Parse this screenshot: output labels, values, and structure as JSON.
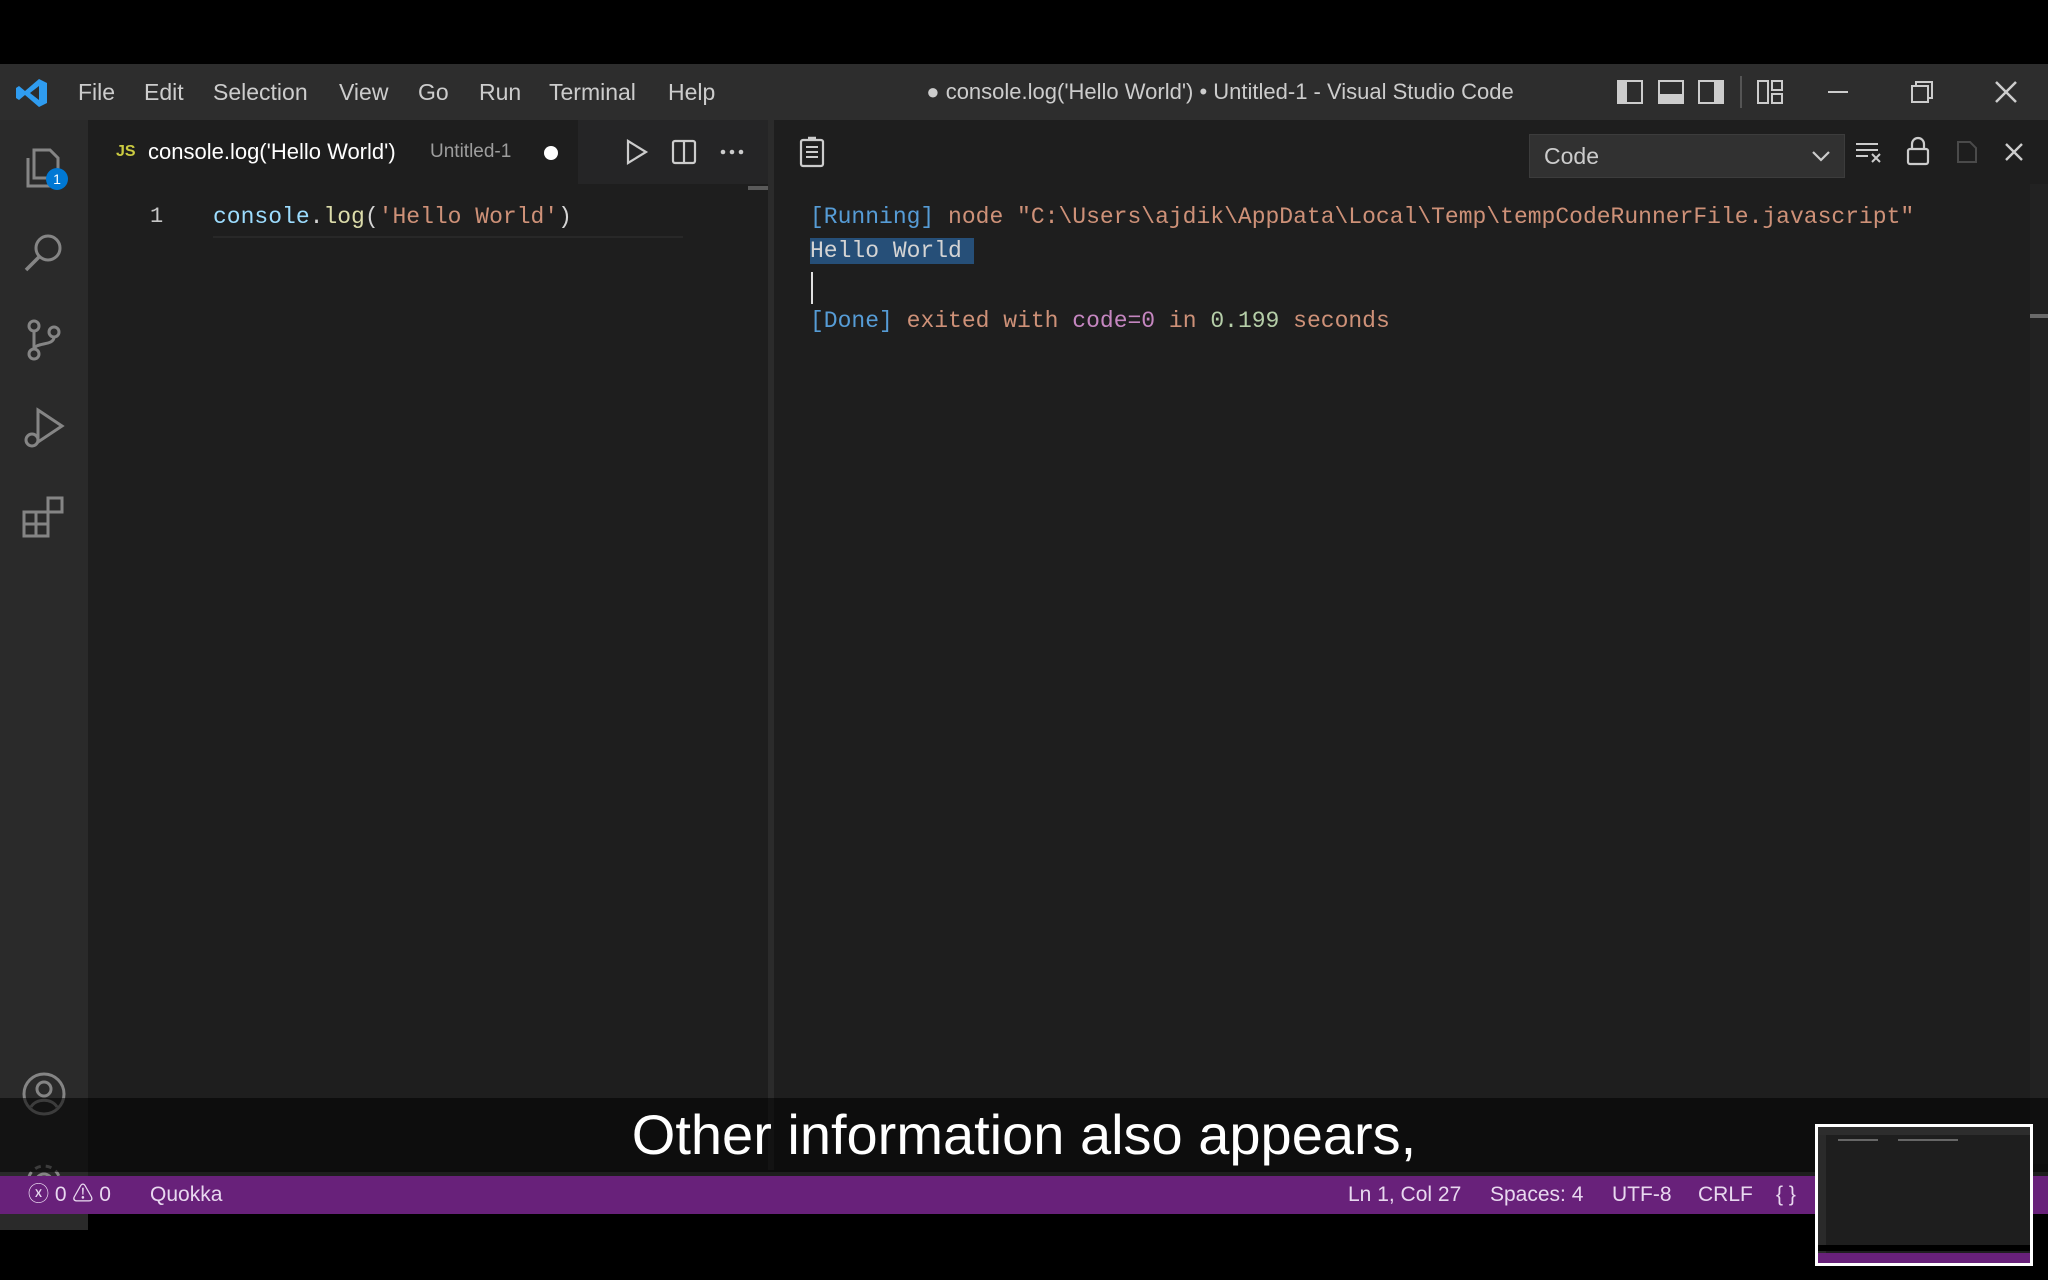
{
  "titlebar": {
    "menus": [
      "File",
      "Edit",
      "Selection",
      "View",
      "Go",
      "Run",
      "Terminal",
      "Help"
    ],
    "title": "● console.log('Hello World') • Untitled-1 - Visual Studio Code"
  },
  "activity": {
    "explorer_badge": "1",
    "icons": [
      "explorer-icon",
      "search-icon",
      "source-control-icon",
      "run-debug-icon",
      "extensions-icon",
      "account-icon",
      "gear-icon"
    ]
  },
  "editor": {
    "tab_badge": "JS",
    "tab_title": "console.log('Hello World')",
    "tab_desc": "Untitled-1",
    "line_number": "1",
    "code": {
      "fn": "console",
      "dot": ".",
      "method": "log",
      "paren_open": "(",
      "string": "'Hello World'",
      "paren_close": ")"
    }
  },
  "output": {
    "channel": "Code",
    "running_tag": "[Running]",
    "running_cmd": "node \"C:\\Users\\ajdik\\AppData\\Local\\Temp\\tempCodeRunnerFile.javascript\"",
    "hello": "Hello World",
    "done_tag": "[Done]",
    "done_text1": "exited with",
    "done_code": "code=0",
    "done_in": "in",
    "done_time": "0.199",
    "done_seconds": "seconds"
  },
  "statusbar": {
    "errors": "0",
    "warnings": "0",
    "quokka": "Quokka",
    "position": "Ln 1, Col 27",
    "spaces": "Spaces: 4",
    "encoding": "UTF-8",
    "eol": "CRLF",
    "language_icon": "{ }"
  },
  "caption": {
    "text": "Other information also appears,"
  },
  "colors": {
    "accent": "#68217a",
    "string": "#ce9178",
    "keyword_blue": "#569cd6",
    "variable": "#9cdcfe",
    "function": "#dcdcaa",
    "purple": "#c586c0",
    "number": "#b5cea8"
  }
}
